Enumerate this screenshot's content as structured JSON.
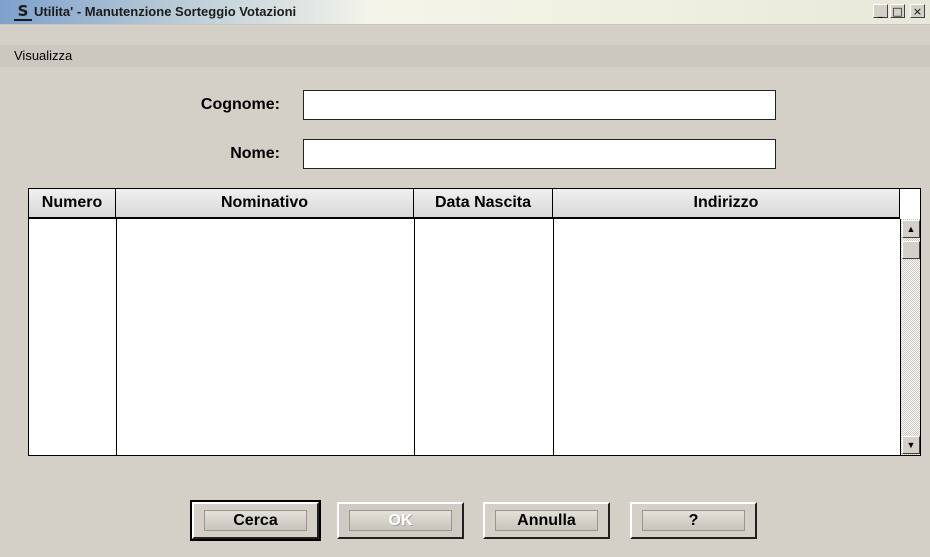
{
  "window": {
    "title": "Utilita' - Manutenzione Sorteggio Votazioni",
    "app_icon_glyph": "S",
    "app_icon": "app-logo-icon",
    "controls": {
      "minimize": "_",
      "maximize": "□",
      "close": "×"
    }
  },
  "menu": {
    "items": [
      {
        "label": "Visualizza"
      }
    ]
  },
  "form": {
    "cognome": {
      "label": "Cognome:",
      "value": ""
    },
    "nome": {
      "label": "Nome:",
      "value": ""
    }
  },
  "grid": {
    "columns": [
      "Numero",
      "Nominativo",
      "Data Nascita",
      "Indirizzo"
    ],
    "rows": [],
    "scroll_up_glyph": "▲",
    "scroll_down_glyph": "▼"
  },
  "buttons": {
    "cerca": "Cerca",
    "ok": "OK",
    "annulla": "Annulla",
    "help": "?"
  },
  "colors": {
    "window_bg": "#d4d0c8",
    "titlebar_left": "#7ea0cc",
    "titlebar_right": "#f0f0e0"
  }
}
